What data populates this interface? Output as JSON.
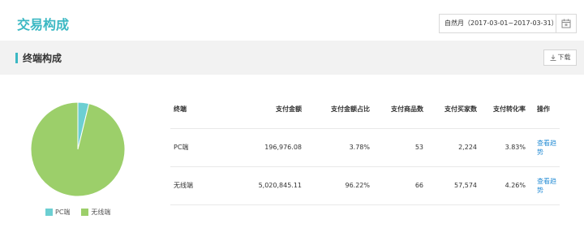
{
  "header": {
    "title": "交易构成",
    "date_label": "自然月（2017-03-01~2017-03-31）"
  },
  "section": {
    "title": "终端构成",
    "download_label": "下载"
  },
  "colors": {
    "accent": "#3bb8c3",
    "pc": "#6ccfd2",
    "wireless": "#9ccf6a",
    "link": "#2a8fd6"
  },
  "legend": [
    "PC端",
    "无线端"
  ],
  "table": {
    "headers": [
      "终端",
      "支付金额",
      "支付金额占比",
      "支付商品数",
      "支付买家数",
      "支付转化率",
      "操作"
    ],
    "rows": [
      [
        "PC端",
        "196,976.08",
        "3.78%",
        "53",
        "2,224",
        "3.83%",
        "查看趋势"
      ],
      [
        "无线端",
        "5,020,845.11",
        "96.22%",
        "66",
        "57,574",
        "4.26%",
        "查看趋势"
      ]
    ]
  },
  "chart_data": {
    "type": "pie",
    "categories": [
      "PC端",
      "无线端"
    ],
    "values": [
      3.78,
      96.22
    ]
  }
}
